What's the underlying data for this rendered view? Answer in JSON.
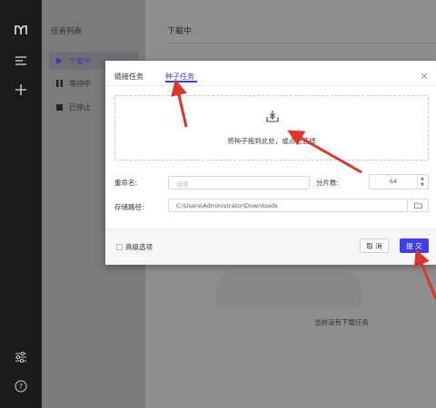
{
  "rail": {
    "icons": [
      "logo-icon",
      "menu-icon",
      "add-icon",
      "settings-sliders-icon",
      "help-icon"
    ]
  },
  "tasklist": {
    "title": "任务列表",
    "items": [
      {
        "label": "下载中",
        "icon": "play-icon",
        "active": true
      },
      {
        "label": "等待中",
        "icon": "pause-icon",
        "active": false
      },
      {
        "label": "已停止",
        "icon": "stop-icon",
        "active": false
      }
    ]
  },
  "main": {
    "header": "下载中",
    "empty_text": "当前没有下载任务"
  },
  "dialog": {
    "tabs": [
      "链接任务",
      "种子任务"
    ],
    "active_tab": 1,
    "dropzone_text": "将种子拖到此处，或点击选择",
    "rename_label": "重命名:",
    "rename_placeholder": "选填",
    "shards_label": "分片数:",
    "shards_value": "64",
    "path_label": "存储路径:",
    "path_value": "C:\\Users\\Administrator\\Downloads",
    "advanced_label": "高级选项",
    "cancel_label": "取 消",
    "submit_label": "提 交"
  },
  "colors": {
    "accent": "#3f3fea",
    "annotation": "#e0352b"
  }
}
